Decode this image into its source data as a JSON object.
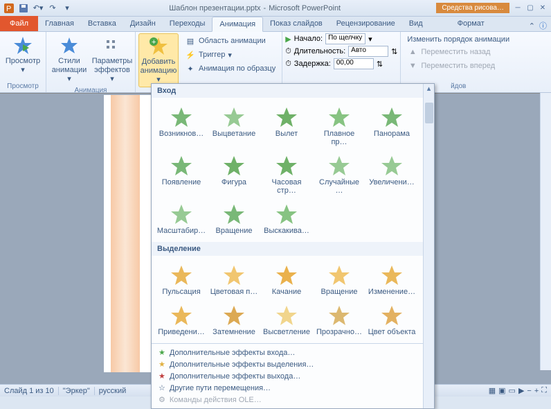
{
  "title": {
    "doc": "Шаблон презентации.pptx",
    "app": "Microsoft PowerPoint"
  },
  "context_tab": "Средства рисова…",
  "tabs": {
    "file": "Файл",
    "items": [
      "Главная",
      "Вставка",
      "Дизайн",
      "Переходы",
      "Анимация",
      "Показ слайдов",
      "Рецензирование",
      "Вид"
    ],
    "format": "Формат"
  },
  "ribbon": {
    "preview": {
      "btn": "Просмотр",
      "group": "Просмотр"
    },
    "anim": {
      "styles": "Стили\nанимации",
      "params": "Параметры\nэффектов",
      "group": "Анимация"
    },
    "add": {
      "btn": "Добавить\nанимацию",
      "pane": "Область анимации",
      "trigger": "Триггер",
      "painter": "Анимация по образцу"
    },
    "timing": {
      "start_lbl": "Начало:",
      "start_val": "По щелчку",
      "dur_lbl": "Длительность:",
      "dur_val": "Авто",
      "delay_lbl": "Задержка:",
      "delay_val": "00,00"
    },
    "reorder": {
      "title": "Изменить порядок анимации",
      "back": "Переместить назад",
      "fwd": "Переместить вперед"
    },
    "transition_group": "йдов"
  },
  "dropdown": {
    "sections": {
      "entry": "Вход",
      "emphasis": "Выделение"
    },
    "entry_items": [
      "Возникнов…",
      "Выцветание",
      "Вылет",
      "Плавное пр…",
      "Панорама",
      "Появление",
      "Фигура",
      "Часовая стр…",
      "Случайные …",
      "Увеличени…",
      "Масштабир…",
      "Вращение",
      "Выскакива…"
    ],
    "emphasis_items": [
      "Пульсация",
      "Цветовая п…",
      "Качание",
      "Вращение",
      "Изменение…",
      "Приведени…",
      "Затемнение",
      "Высветление",
      "Прозрачно…",
      "Цвет объекта"
    ],
    "footer": [
      "Дополнительные эффекты входа…",
      "Дополнительные эффекты выделения…",
      "Дополнительные эффекты выхода…",
      "Другие пути перемещения…",
      "Команды действия OLE…"
    ]
  },
  "status": {
    "slide": "Слайд 1 из 10",
    "theme": "\"Эркер\"",
    "lang": "русский"
  }
}
